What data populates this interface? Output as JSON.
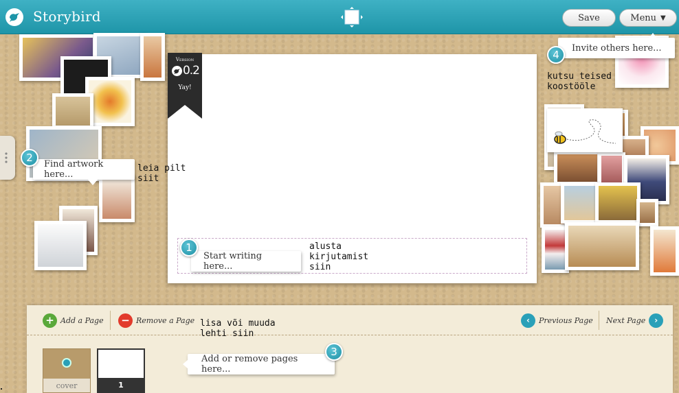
{
  "app": {
    "brand": "Storybird",
    "save_label": "Save",
    "menu_label": "Menu",
    "menu_caret": "▼"
  },
  "version_ribbon": {
    "word": "Version",
    "number": "0.2",
    "tagline": "Yay!"
  },
  "hints": {
    "start_writing": {
      "number": "1",
      "text": "Start writing here...",
      "note": "alusta\nkirjutamist\nsiin"
    },
    "find_artwork": {
      "number": "2",
      "text": "Find artwork here...",
      "note": "leia pilt\nsiit"
    },
    "pages": {
      "number": "3",
      "text": "Add or remove pages here...",
      "note": "lisa või muuda\nlehti siin"
    },
    "invite": {
      "number": "4",
      "text": "Invite others here...",
      "note": "kutsu teised\nkoostööle"
    }
  },
  "page_toolbar": {
    "add_page": "Add a Page",
    "remove_page": "Remove a Page",
    "previous_page": "Previous Page",
    "next_page": "Next Page"
  },
  "page_strip": {
    "cover_label": "cover",
    "page1_label": "1"
  },
  "colors": {
    "topbar": "#1e95a8",
    "accent": "#2aa0b8",
    "add_green": "#5aa83a",
    "remove_red": "#e23b2c"
  }
}
